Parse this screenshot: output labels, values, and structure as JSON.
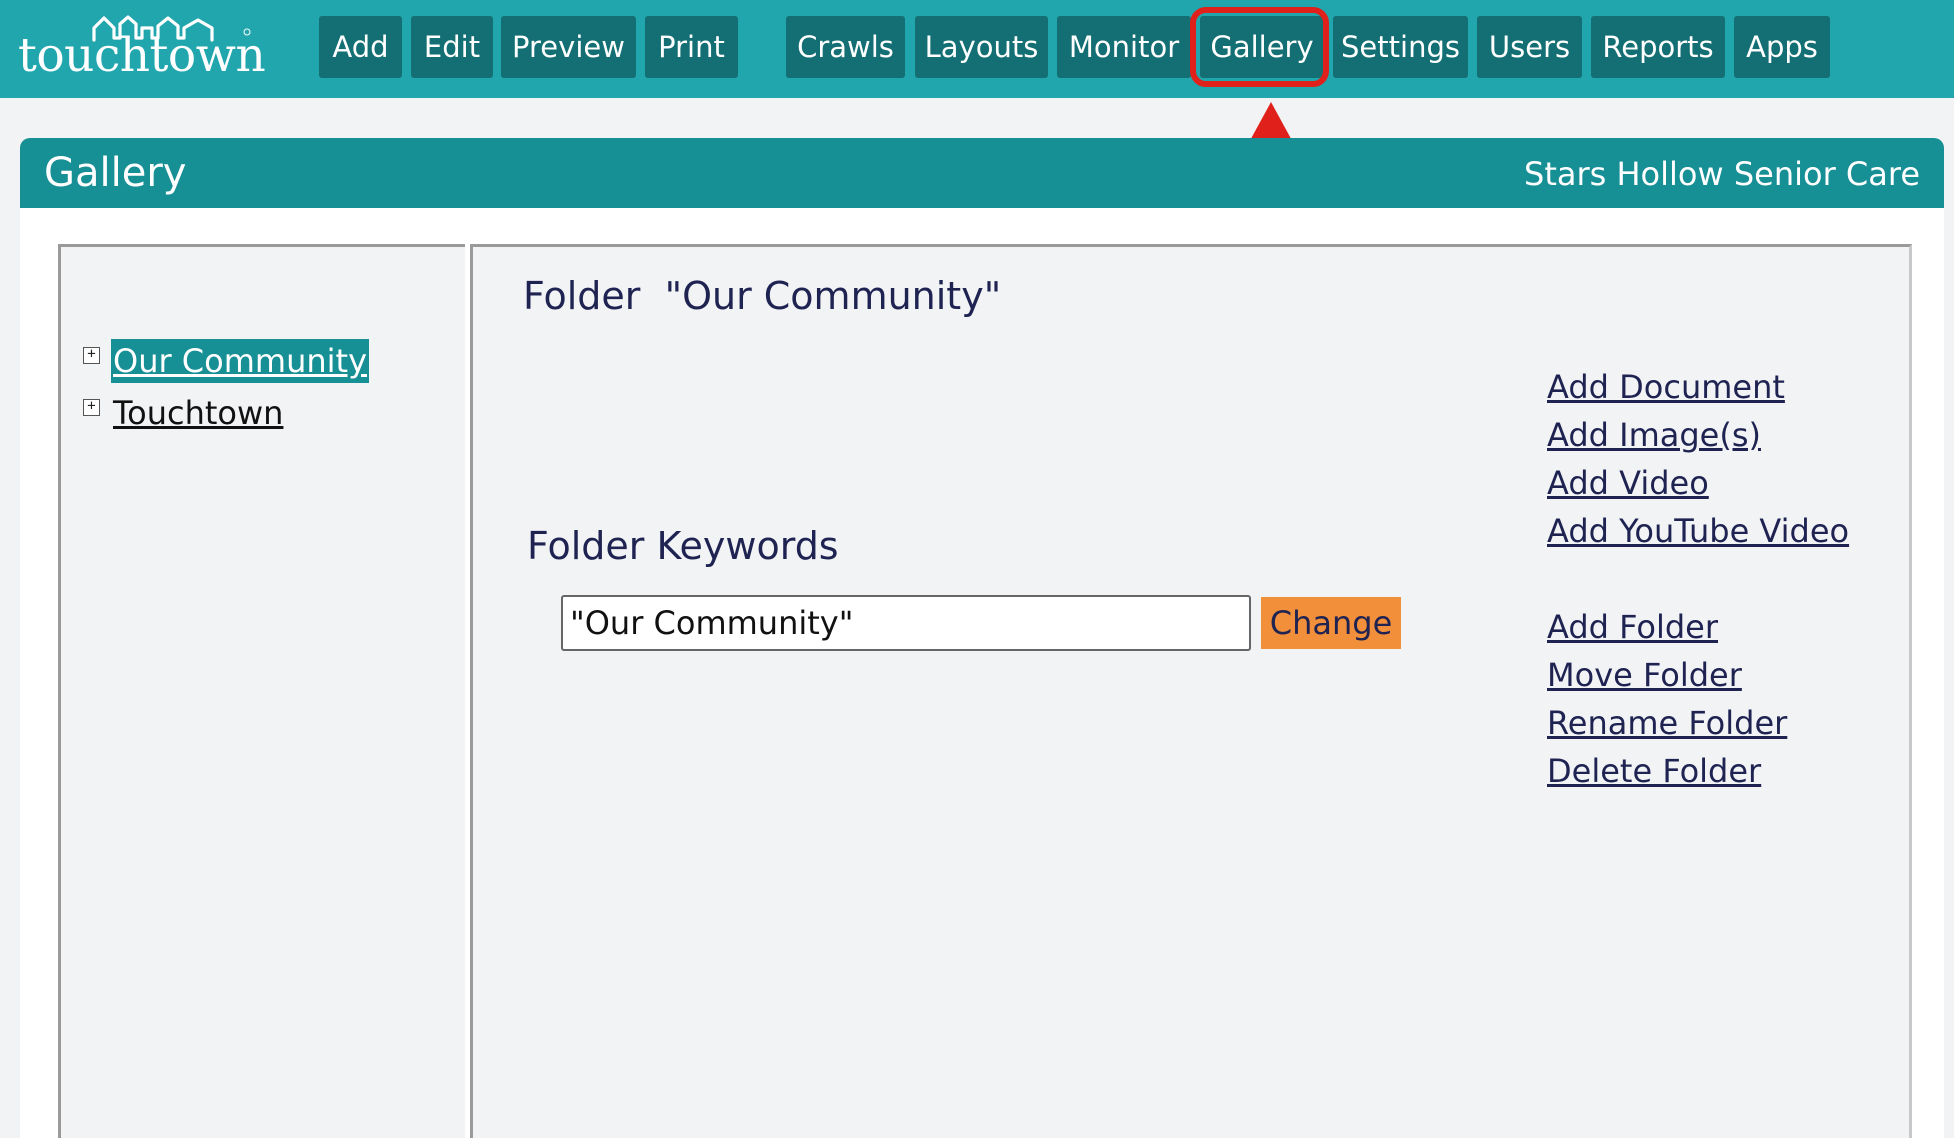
{
  "app": {
    "logo_text": "touchtown"
  },
  "nav": {
    "add": "Add",
    "edit": "Edit",
    "preview": "Preview",
    "print": "Print",
    "crawls": "Crawls",
    "layouts": "Layouts",
    "monitor": "Monitor",
    "gallery": "Gallery",
    "settings": "Settings",
    "users": "Users",
    "reports": "Reports",
    "apps": "Apps"
  },
  "header": {
    "title": "Gallery",
    "organization": "Stars Hollow Senior Care"
  },
  "tree": {
    "items": [
      {
        "label": "Our Community",
        "selected": true,
        "expander": "+"
      },
      {
        "label": "Touchtown",
        "selected": false,
        "expander": "+"
      }
    ]
  },
  "folder": {
    "title": "Folder  \"Our Community\"",
    "keywords_heading": "Folder Keywords",
    "keywords_value": "\"Our Community\"",
    "change_label": "Change"
  },
  "actions": {
    "add_document": "Add Document",
    "add_images": "Add Image(s)",
    "add_video": "Add Video",
    "add_youtube": "Add YouTube Video",
    "add_folder": "Add Folder",
    "move_folder": "Move Folder",
    "rename_folder": "Rename Folder",
    "delete_folder": "Delete Folder"
  },
  "colors": {
    "topbar": "#21a6ae",
    "nav_button": "#136f73",
    "panel_header": "#168f95",
    "change_button": "#f28f3b",
    "highlight": "#e0201b"
  }
}
